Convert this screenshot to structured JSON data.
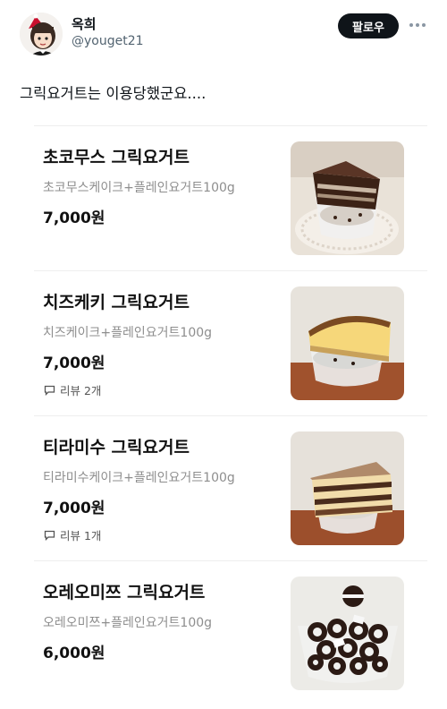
{
  "user": {
    "display_name": "옥희",
    "handle": "@youget21",
    "avatar_icon": "cartoon-avatar"
  },
  "actions": {
    "follow_label": "팔로우",
    "more_icon": "more-dots-icon"
  },
  "tweet": {
    "text": "그릭요거트는 이용당했군요...."
  },
  "menu": {
    "items": [
      {
        "name": "초코무스 그릭요거트",
        "description": "초코무스케이크+플레인요거트100g",
        "price": "7,000원",
        "review": ""
      },
      {
        "name": "치즈케키 그릭요거트",
        "description": "치즈케이크+플레인요거트100g",
        "price": "7,000원",
        "review": "리뷰 2개"
      },
      {
        "name": "티라미수 그릭요거트",
        "description": "티라미수케이크+플레인요거트100g",
        "price": "7,000원",
        "review": "리뷰 1개"
      },
      {
        "name": "오레오미쯔 그릭요거트",
        "description": "오레오미쯔+플레인요거트100g",
        "price": "6,000원",
        "review": ""
      }
    ]
  },
  "colors": {
    "text_primary": "#0f1419",
    "text_secondary": "#536471",
    "follow_button": "#0f1419",
    "description": "#8e8e8e"
  }
}
